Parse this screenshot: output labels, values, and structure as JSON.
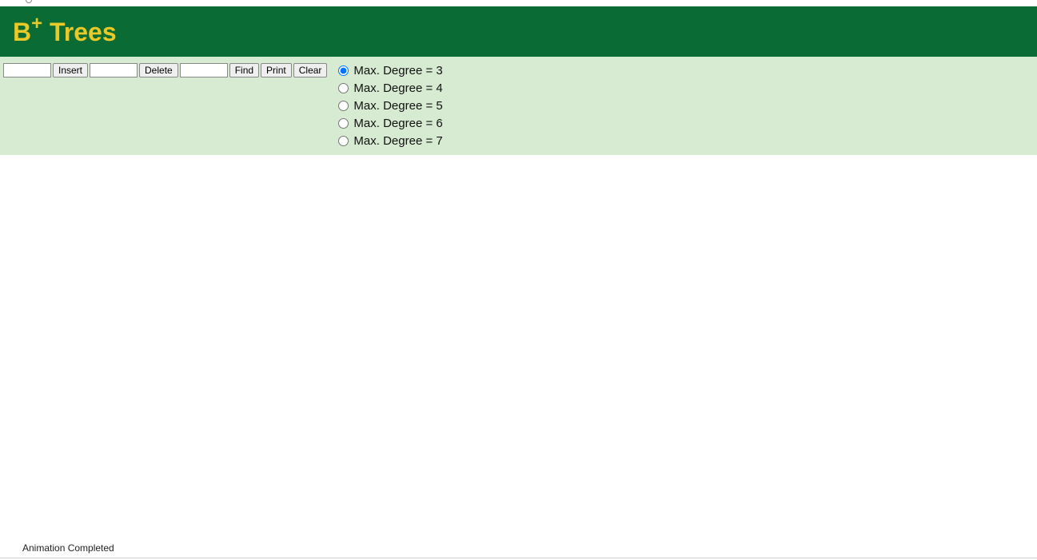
{
  "header": {
    "title_prefix": "B",
    "title_sup": "+",
    "title_rest": " Trees"
  },
  "controls": {
    "insert_value": "",
    "insert_label": "Insert",
    "delete_value": "",
    "delete_label": "Delete",
    "find_value": "",
    "find_label": "Find",
    "print_label": "Print",
    "clear_label": "Clear"
  },
  "degree_options": [
    {
      "label": "Max. Degree = 3",
      "checked": true
    },
    {
      "label": "Max. Degree = 4",
      "checked": false
    },
    {
      "label": "Max. Degree = 5",
      "checked": false
    },
    {
      "label": "Max. Degree = 6",
      "checked": false
    },
    {
      "label": "Max. Degree = 7",
      "checked": false
    }
  ],
  "status": {
    "text": "Animation Completed"
  },
  "colors": {
    "header_bg": "#0a6b34",
    "header_text": "#e9c927",
    "controls_bg": "#d7ebd2"
  }
}
